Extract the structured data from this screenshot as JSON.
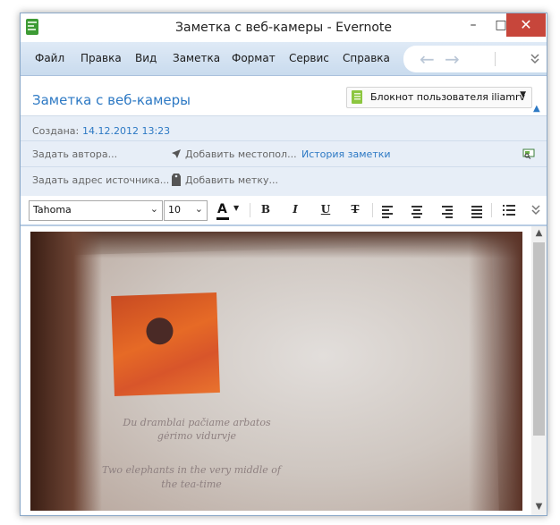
{
  "window": {
    "title": "Заметка с веб-камеры - Evernote",
    "minimize": "–",
    "maximize": "□",
    "close": "✕"
  },
  "menu": {
    "items": [
      "Файл",
      "Правка",
      "Вид",
      "Заметка",
      "Формат",
      "Сервис",
      "Справка"
    ],
    "back": "←",
    "forward": "→",
    "more": "⌄"
  },
  "note": {
    "title": "Заметка с веб-камеры",
    "notebook": "Блокнот пользователя iliamrv",
    "notebook_caret": "▼",
    "collapse": "▲"
  },
  "meta": {
    "created_label": "Создана:",
    "created_value": "14.12.2012 13:23",
    "set_author": "Задать автора...",
    "add_location": "Добавить местопол...",
    "history": "История заметки",
    "set_source": "Задать адрес источника...",
    "add_tag": "Добавить метку..."
  },
  "format": {
    "font": "Tahoma",
    "size": "10",
    "font_color_label": "A",
    "bold": "B",
    "italic": "I",
    "underline": "U",
    "strike": "T",
    "more": "⌄"
  },
  "photo": {
    "caption_ru_1": "Du dramblai pačiame arbatos",
    "caption_ru_2": "gėrimo vidurvje",
    "caption_en_1": "Two elephants in the very middle of",
    "caption_en_2": "the tea-time"
  },
  "icons": {
    "app": "evernote-icon",
    "notebook": "notebook-icon",
    "location": "location-icon",
    "tag": "tag-icon",
    "presentation": "presentation-icon",
    "accent": "#2d79c4"
  }
}
